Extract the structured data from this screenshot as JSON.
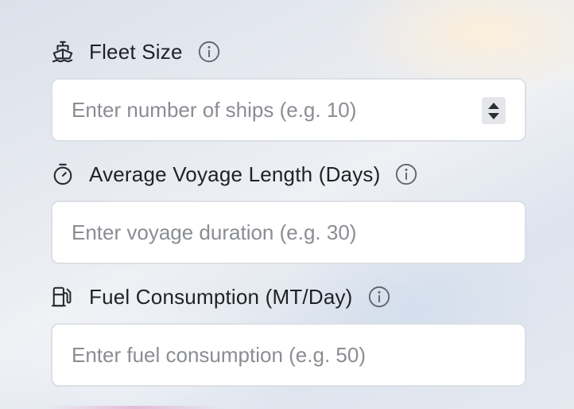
{
  "form": {
    "fields": [
      {
        "id": "fleet-size",
        "label": "Fleet Size",
        "icon": "ship-icon",
        "placeholder": "Enter number of ships (e.g. 10)",
        "value": "",
        "type": "number"
      },
      {
        "id": "voyage-length",
        "label": "Average Voyage Length (Days)",
        "icon": "stopwatch-icon",
        "placeholder": "Enter voyage duration (e.g. 30)",
        "value": "",
        "type": "number"
      },
      {
        "id": "fuel-consumption",
        "label": "Fuel Consumption (MT/Day)",
        "icon": "fuel-pump-icon",
        "placeholder": "Enter fuel consumption (e.g. 50)",
        "value": "",
        "type": "number"
      }
    ]
  },
  "colors": {
    "text": "#1f2126",
    "placeholder": "#8a8d93",
    "input_border": "#dcdfe4",
    "info_icon": "#60646c"
  }
}
